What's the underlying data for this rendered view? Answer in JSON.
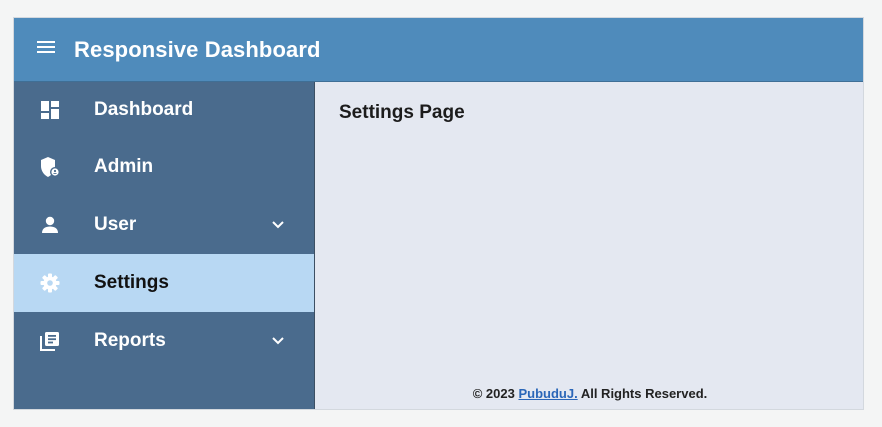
{
  "header": {
    "title": "Responsive Dashboard",
    "menu_icon": "hamburger-menu-icon"
  },
  "colors": {
    "header_bg": "#4f8bbb",
    "sidebar_bg": "#4a6b8d",
    "active_item_bg": "#b8d8f3",
    "content_bg": "#e4e8f1"
  },
  "sidebar": {
    "items": [
      {
        "label": "Dashboard",
        "icon": "dashboard-icon",
        "active": false,
        "expandable": false
      },
      {
        "label": "Admin",
        "icon": "admin-shield-icon",
        "active": false,
        "expandable": false
      },
      {
        "label": "User",
        "icon": "user-icon",
        "active": false,
        "expandable": true
      },
      {
        "label": "Settings",
        "icon": "gear-icon",
        "active": true,
        "expandable": false
      },
      {
        "label": "Reports",
        "icon": "reports-icon",
        "active": false,
        "expandable": true
      }
    ]
  },
  "main": {
    "page_title": "Settings Page"
  },
  "footer": {
    "prefix": "© 2023",
    "link_text": "PubuduJ.",
    "suffix": "All Rights Reserved."
  }
}
